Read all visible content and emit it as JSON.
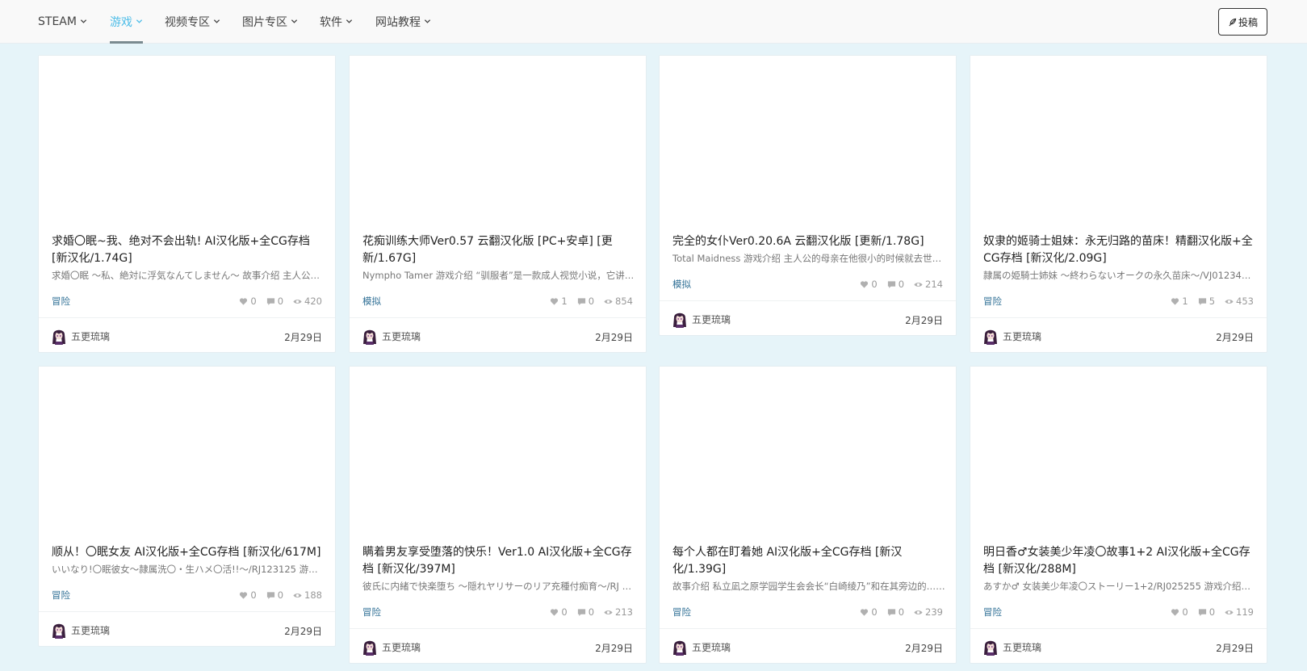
{
  "nav": {
    "items": [
      {
        "label": "STEAM",
        "active": false
      },
      {
        "label": "游戏",
        "active": true
      },
      {
        "label": "视频专区",
        "active": false
      },
      {
        "label": "图片专区",
        "active": false
      },
      {
        "label": "软件",
        "active": false
      },
      {
        "label": "网站教程",
        "active": false
      }
    ],
    "post_label": "投稿",
    "active_color": "#4dbde8"
  },
  "cards": [
    {
      "title": "求婚〇眠~我、绝对不会出轨! AI汉化版+全CG存档 [新汉化/1.74G]",
      "excerpt": "求婚〇眠 ～私、絶対に浮気なんてしません～ 故事介绍 主人公是一名大学生，他和女友……",
      "category": "冒险",
      "likes": "0",
      "comments": "0",
      "views": "420",
      "author": "五更琉璃",
      "date": "2月29日"
    },
    {
      "title": "花痴训练大师Ver0.57 云翻汉化版 [PC+安卓] [更新/1.67G]",
      "excerpt": "Nympho Tamer 游戏介绍 “驯服者”是一款成人视觉小说，它讲述了……",
      "category": "模拟",
      "likes": "1",
      "comments": "0",
      "views": "854",
      "author": "五更琉璃",
      "date": "2月29日"
    },
    {
      "title": "完全的女仆Ver0.20.6A 云翻汉化版 [更新/1.78G]",
      "excerpt": "Total Maidness 游戏介绍 主人公的母亲在他很小的时候就去世了……",
      "category": "模拟",
      "likes": "0",
      "comments": "0",
      "views": "214",
      "author": "五更琉璃",
      "date": "2月29日"
    },
    {
      "title": "奴隶的姬骑士姐妹：永无归路的苗床！精翻汉化版+全CG存档 [新汉化/2.09G]",
      "excerpt": "隷属の姫騎士姉妹 ～終わらないオークの永久苗床～/VJ012345 游戏介绍……",
      "category": "冒险",
      "likes": "1",
      "comments": "5",
      "views": "453",
      "author": "五更琉璃",
      "date": "2月29日"
    },
    {
      "title": "顺从！〇眠女友 AI汉化版+全CG存档 [新汉化/617M]",
      "excerpt": "いいなり!〇眠彼女～隷属洗〇・生ハメ〇活!!～/RJ123125 游戏介绍……",
      "category": "冒险",
      "likes": "0",
      "comments": "0",
      "views": "188",
      "author": "五更琉璃",
      "date": "2月29日"
    },
    {
      "title": "瞒着男友享受堕落的快乐！Ver1.0 AI汉化版+全CG存档 [新汉化/397M]",
      "excerpt": "彼氏に内緒で快楽堕ち ～隠れヤリサーのリア充種付痴育～/RJ 游戏介绍……",
      "category": "冒险",
      "likes": "0",
      "comments": "0",
      "views": "213",
      "author": "五更琉璃",
      "date": "2月29日"
    },
    {
      "title": "每个人都在盯着她 AI汉化版+全CG存档 [新汉化/1.39G]",
      "excerpt": "故事介绍 私立凪之原学园学生会会长“白崎绫乃”和在其旁边的……",
      "category": "冒险",
      "likes": "0",
      "comments": "0",
      "views": "239",
      "author": "五更琉璃",
      "date": "2月29日"
    },
    {
      "title": "明日香♂女装美少年凌〇故事1+2 AI汉化版+全CG存档 [新汉化/288M]",
      "excerpt": "あすか♂ 女装美少年凌〇ストーリー1+2/RJ025255 游戏介绍……",
      "category": "冒险",
      "likes": "0",
      "comments": "0",
      "views": "119",
      "author": "五更琉璃",
      "date": "2月29日"
    }
  ]
}
